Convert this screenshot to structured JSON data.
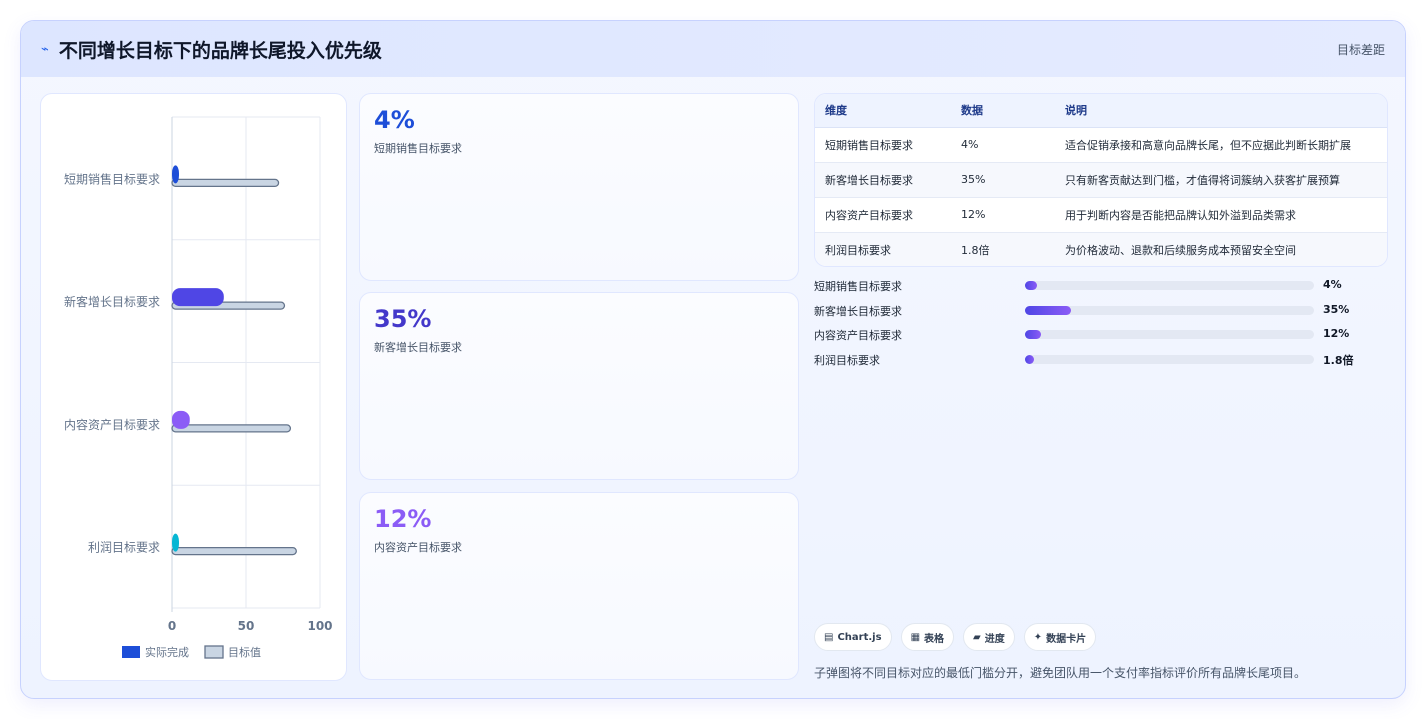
{
  "header": {
    "icon": "trend-line-icon",
    "title": "不同增长目标下的品牌长尾投入优先级",
    "right_label": "目标差距"
  },
  "chart_data": {
    "type": "bar",
    "orientation": "horizontal",
    "categories": [
      "短期销售目标要求",
      "新客增长目标要求",
      "内容资产目标要求",
      "利润目标要求"
    ],
    "series": [
      {
        "name": "实际完成",
        "values": [
          4,
          35,
          12,
          4
        ],
        "colors": [
          "#1d4ed8",
          "#4f46e5",
          "#8b5cf6",
          "#06b6d4"
        ]
      },
      {
        "name": "目标值",
        "values": [
          72,
          76,
          80,
          84
        ],
        "color": "#c9d5e3"
      }
    ],
    "xlim": [
      0,
      100
    ],
    "xticks": [
      "0",
      "50",
      "100"
    ],
    "grid": true,
    "legend": "bottom"
  },
  "stat_cards": [
    {
      "value": "4%",
      "label": "短期销售目标要求",
      "color": "#1d4ed8"
    },
    {
      "value": "35%",
      "label": "新客增长目标要求",
      "color": "#4338ca"
    },
    {
      "value": "12%",
      "label": "内容资产目标要求",
      "color": "#8b5cf6"
    }
  ],
  "table": {
    "headers": [
      "维度",
      "数据",
      "说明"
    ],
    "rows": [
      [
        "短期销售目标要求",
        "4%",
        "适合促销承接和高意向品牌长尾，但不应据此判断长期扩展"
      ],
      [
        "新客增长目标要求",
        "35%",
        "只有新客贡献达到门槛，才值得将词簇纳入获客扩展预算"
      ],
      [
        "内容资产目标要求",
        "12%",
        "用于判断内容是否能把品牌认知外溢到品类需求"
      ],
      [
        "利润目标要求",
        "1.8倍",
        "为价格波动、退款和后续服务成本预留安全空间"
      ]
    ]
  },
  "progress": [
    {
      "label": "短期销售目标要求",
      "value_text": "4%",
      "fraction": 0.04
    },
    {
      "label": "新客增长目标要求",
      "value_text": "35%",
      "fraction": 0.16
    },
    {
      "label": "内容资产目标要求",
      "value_text": "12%",
      "fraction": 0.055
    },
    {
      "label": "利润目标要求",
      "value_text": "1.8倍",
      "fraction": 0.03
    }
  ],
  "tags": [
    {
      "icon": "chart-icon",
      "label": "Chart.js"
    },
    {
      "icon": "table-icon",
      "label": "表格"
    },
    {
      "icon": "progress-icon",
      "label": "进度"
    },
    {
      "icon": "sparkle-icon",
      "label": "数据卡片"
    }
  ],
  "note": "子弹图将不同目标对应的最低门槛分开，避免团队用一个支付率指标评价所有品牌长尾项目。"
}
